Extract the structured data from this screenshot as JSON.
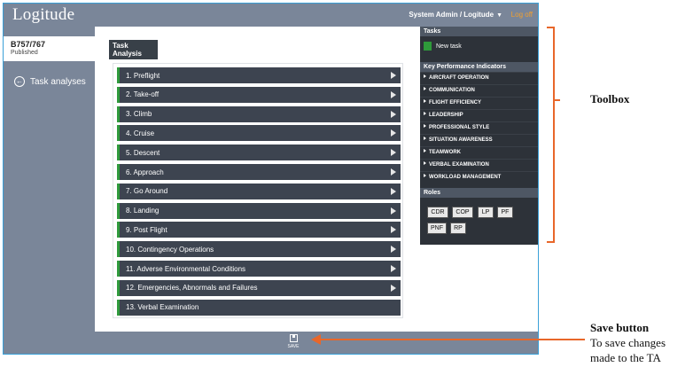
{
  "app": {
    "logo": "Logitude"
  },
  "header": {
    "user": "System Admin / Logitude",
    "logoff": "Log off"
  },
  "sidebar": {
    "aircraft_name": "B757/767",
    "aircraft_status": "Published",
    "task_analyses_label": "Task analyses"
  },
  "main": {
    "heading": "Task Analysis",
    "tasks": [
      "1. Preflight",
      "2. Take-off",
      "3. Climb",
      "4. Cruise",
      "5. Descent",
      "6. Approach",
      "7. Go Around",
      "8. Landing",
      "9. Post Flight",
      "10. Contingency Operations",
      "11. Adverse Environmental Conditions",
      "12. Emergencies, Abnormals and Failures",
      "13. Verbal Examination"
    ]
  },
  "toolbox": {
    "tasks_header": "Tasks",
    "new_task_label": "New task",
    "kpi_header": "Key Performance Indicators",
    "kpis": [
      "AIRCRAFT OPERATION",
      "COMMUNICATION",
      "FLIGHT EFFICIENCY",
      "LEADERSHIP",
      "PROFESSIONAL STYLE",
      "SITUATION AWARENESS",
      "TEAMWORK",
      "VERBAL EXAMINATION",
      "WORKLOAD MANAGEMENT"
    ],
    "roles_header": "Roles",
    "roles": [
      "CDR",
      "COP",
      "LP",
      "PF",
      "PNF",
      "RP"
    ]
  },
  "footer": {
    "save_label": "SAVE"
  },
  "annotations": {
    "toolbox": "Toolbox",
    "save_title": "Save button",
    "save_line1": "To save changes",
    "save_line2": "made to the TA"
  },
  "colors": {
    "frame": "#7a8699",
    "dark_row": "#3d4450",
    "accent_green": "#2f9a3c",
    "logoff_orange": "#f0a030",
    "annotation_orange": "#e8672a"
  }
}
